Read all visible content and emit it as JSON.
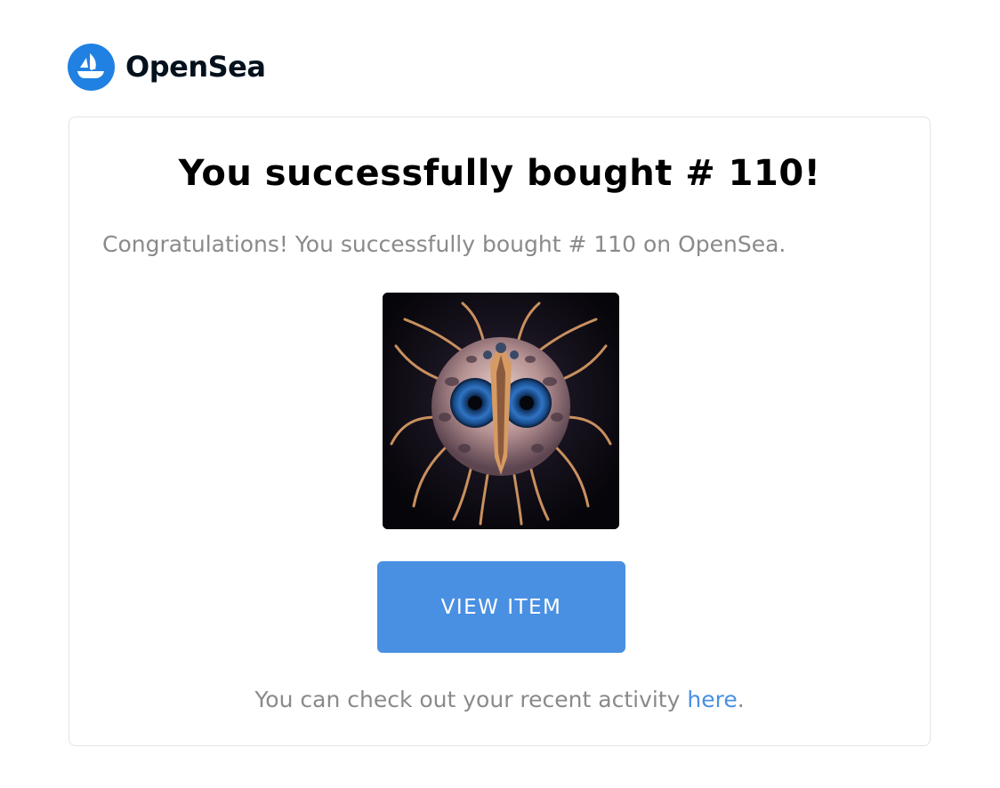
{
  "brand": {
    "name": "OpenSea",
    "logo_icon": "opensea-ship-icon",
    "logo_color": "#2081e2"
  },
  "card": {
    "title": "You successfully bought # 110!",
    "message": "Congratulations! You successfully bought # 110 on OpenSea.",
    "item_image_icon": "nft-creature-image",
    "button_label": "VIEW ITEM",
    "button_color": "#4a90e2",
    "footer_text": "You can check out your recent activity ",
    "footer_link_label": "here",
    "footer_suffix": ".",
    "link_color": "#4a90e2"
  }
}
